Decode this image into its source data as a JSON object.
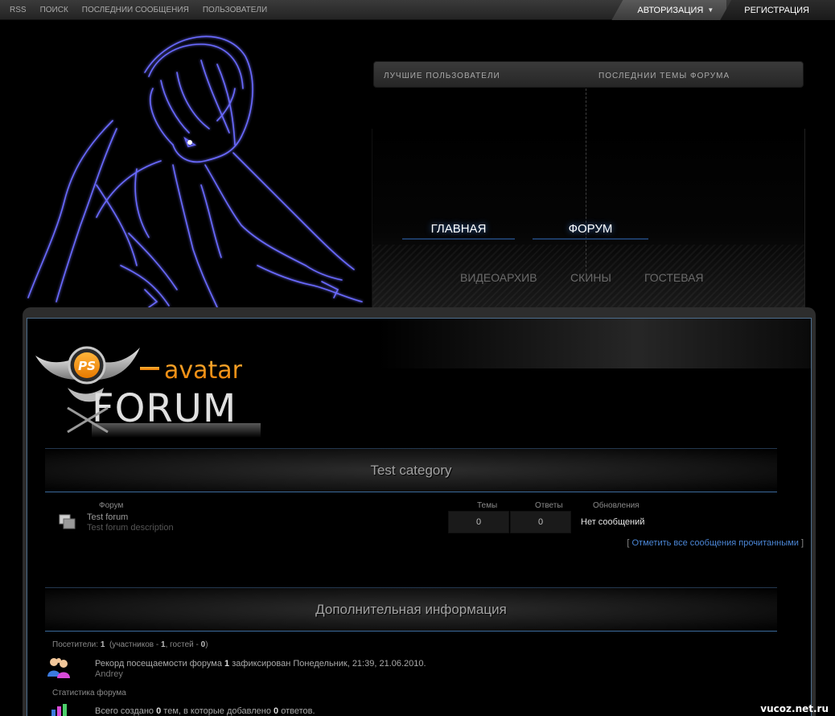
{
  "topbar": {
    "links": [
      "RSS",
      "Поиск",
      "Последнии сообщения",
      "Пользователи"
    ],
    "login_label": "Авторизация",
    "register_label": "Регистрация"
  },
  "info_panel": {
    "best_users": "Лучшие пользователи",
    "latest_topics": "Последнии темы форума"
  },
  "main_nav": {
    "home": "Главная",
    "forum": "Форум"
  },
  "sub_nav": {
    "video": "Видеоархив",
    "skins": "Скины",
    "guestbook": "Гостевая"
  },
  "logo": {
    "badge": "PS",
    "line1": "avatar",
    "line2": "FORUM"
  },
  "category": {
    "title": "Test category",
    "columns": {
      "forum": "Форум",
      "topics": "Темы",
      "replies": "Ответы",
      "updates": "Обновления"
    },
    "forums": [
      {
        "title": "Test forum",
        "description": "Test forum description",
        "topics": "0",
        "replies": "0",
        "last_post": "Нет сообщений"
      }
    ],
    "mark_read_open": "[",
    "mark_read": "Отметить все сообщения прочитанными",
    "mark_read_close": "]"
  },
  "extra_info": {
    "title": "Дополнительная информация",
    "visitors_label": "Посетители:",
    "visitors_total": "1",
    "members_label": "(участников -",
    "members": "1",
    "guests_label": ", гостей -",
    "guests": "0",
    "close_paren": ")",
    "record_prefix": "Рекорд посещаемости форума",
    "record_count": "1",
    "record_suffix": "зафиксирован Понедельник, 21:39, 21.06.2010.",
    "record_user": "Andrey",
    "stats_label": "Статистика форума",
    "stats_prefix": "Всего создано",
    "stats_topics": "0",
    "stats_middle": "тем, в которые добавлено",
    "stats_replies": "0",
    "stats_suffix": "ответов."
  },
  "watermark": "vucoz.net.ru",
  "colors": {
    "accent_blue": "#4b86d6",
    "frame_border": "#4d6e8e",
    "hero_lines": "#6b6bff"
  }
}
